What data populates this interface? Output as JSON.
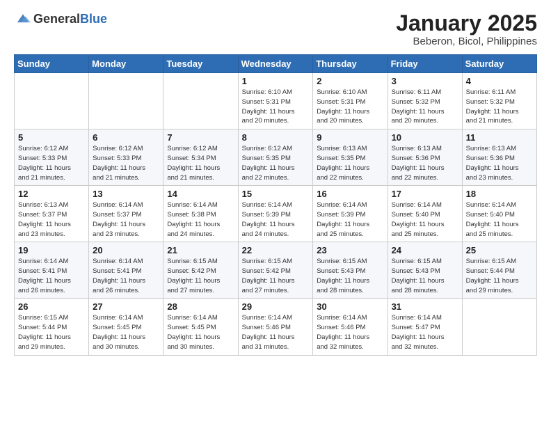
{
  "header": {
    "logo_general": "General",
    "logo_blue": "Blue",
    "month_title": "January 2025",
    "location": "Beberon, Bicol, Philippines"
  },
  "weekdays": [
    "Sunday",
    "Monday",
    "Tuesday",
    "Wednesday",
    "Thursday",
    "Friday",
    "Saturday"
  ],
  "weeks": [
    [
      {
        "day": "",
        "info": ""
      },
      {
        "day": "",
        "info": ""
      },
      {
        "day": "",
        "info": ""
      },
      {
        "day": "1",
        "info": "Sunrise: 6:10 AM\nSunset: 5:31 PM\nDaylight: 11 hours\nand 20 minutes."
      },
      {
        "day": "2",
        "info": "Sunrise: 6:10 AM\nSunset: 5:31 PM\nDaylight: 11 hours\nand 20 minutes."
      },
      {
        "day": "3",
        "info": "Sunrise: 6:11 AM\nSunset: 5:32 PM\nDaylight: 11 hours\nand 20 minutes."
      },
      {
        "day": "4",
        "info": "Sunrise: 6:11 AM\nSunset: 5:32 PM\nDaylight: 11 hours\nand 21 minutes."
      }
    ],
    [
      {
        "day": "5",
        "info": "Sunrise: 6:12 AM\nSunset: 5:33 PM\nDaylight: 11 hours\nand 21 minutes."
      },
      {
        "day": "6",
        "info": "Sunrise: 6:12 AM\nSunset: 5:33 PM\nDaylight: 11 hours\nand 21 minutes."
      },
      {
        "day": "7",
        "info": "Sunrise: 6:12 AM\nSunset: 5:34 PM\nDaylight: 11 hours\nand 21 minutes."
      },
      {
        "day": "8",
        "info": "Sunrise: 6:12 AM\nSunset: 5:35 PM\nDaylight: 11 hours\nand 22 minutes."
      },
      {
        "day": "9",
        "info": "Sunrise: 6:13 AM\nSunset: 5:35 PM\nDaylight: 11 hours\nand 22 minutes."
      },
      {
        "day": "10",
        "info": "Sunrise: 6:13 AM\nSunset: 5:36 PM\nDaylight: 11 hours\nand 22 minutes."
      },
      {
        "day": "11",
        "info": "Sunrise: 6:13 AM\nSunset: 5:36 PM\nDaylight: 11 hours\nand 23 minutes."
      }
    ],
    [
      {
        "day": "12",
        "info": "Sunrise: 6:13 AM\nSunset: 5:37 PM\nDaylight: 11 hours\nand 23 minutes."
      },
      {
        "day": "13",
        "info": "Sunrise: 6:14 AM\nSunset: 5:37 PM\nDaylight: 11 hours\nand 23 minutes."
      },
      {
        "day": "14",
        "info": "Sunrise: 6:14 AM\nSunset: 5:38 PM\nDaylight: 11 hours\nand 24 minutes."
      },
      {
        "day": "15",
        "info": "Sunrise: 6:14 AM\nSunset: 5:39 PM\nDaylight: 11 hours\nand 24 minutes."
      },
      {
        "day": "16",
        "info": "Sunrise: 6:14 AM\nSunset: 5:39 PM\nDaylight: 11 hours\nand 25 minutes."
      },
      {
        "day": "17",
        "info": "Sunrise: 6:14 AM\nSunset: 5:40 PM\nDaylight: 11 hours\nand 25 minutes."
      },
      {
        "day": "18",
        "info": "Sunrise: 6:14 AM\nSunset: 5:40 PM\nDaylight: 11 hours\nand 25 minutes."
      }
    ],
    [
      {
        "day": "19",
        "info": "Sunrise: 6:14 AM\nSunset: 5:41 PM\nDaylight: 11 hours\nand 26 minutes."
      },
      {
        "day": "20",
        "info": "Sunrise: 6:14 AM\nSunset: 5:41 PM\nDaylight: 11 hours\nand 26 minutes."
      },
      {
        "day": "21",
        "info": "Sunrise: 6:15 AM\nSunset: 5:42 PM\nDaylight: 11 hours\nand 27 minutes."
      },
      {
        "day": "22",
        "info": "Sunrise: 6:15 AM\nSunset: 5:42 PM\nDaylight: 11 hours\nand 27 minutes."
      },
      {
        "day": "23",
        "info": "Sunrise: 6:15 AM\nSunset: 5:43 PM\nDaylight: 11 hours\nand 28 minutes."
      },
      {
        "day": "24",
        "info": "Sunrise: 6:15 AM\nSunset: 5:43 PM\nDaylight: 11 hours\nand 28 minutes."
      },
      {
        "day": "25",
        "info": "Sunrise: 6:15 AM\nSunset: 5:44 PM\nDaylight: 11 hours\nand 29 minutes."
      }
    ],
    [
      {
        "day": "26",
        "info": "Sunrise: 6:15 AM\nSunset: 5:44 PM\nDaylight: 11 hours\nand 29 minutes."
      },
      {
        "day": "27",
        "info": "Sunrise: 6:14 AM\nSunset: 5:45 PM\nDaylight: 11 hours\nand 30 minutes."
      },
      {
        "day": "28",
        "info": "Sunrise: 6:14 AM\nSunset: 5:45 PM\nDaylight: 11 hours\nand 30 minutes."
      },
      {
        "day": "29",
        "info": "Sunrise: 6:14 AM\nSunset: 5:46 PM\nDaylight: 11 hours\nand 31 minutes."
      },
      {
        "day": "30",
        "info": "Sunrise: 6:14 AM\nSunset: 5:46 PM\nDaylight: 11 hours\nand 32 minutes."
      },
      {
        "day": "31",
        "info": "Sunrise: 6:14 AM\nSunset: 5:47 PM\nDaylight: 11 hours\nand 32 minutes."
      },
      {
        "day": "",
        "info": ""
      }
    ]
  ]
}
